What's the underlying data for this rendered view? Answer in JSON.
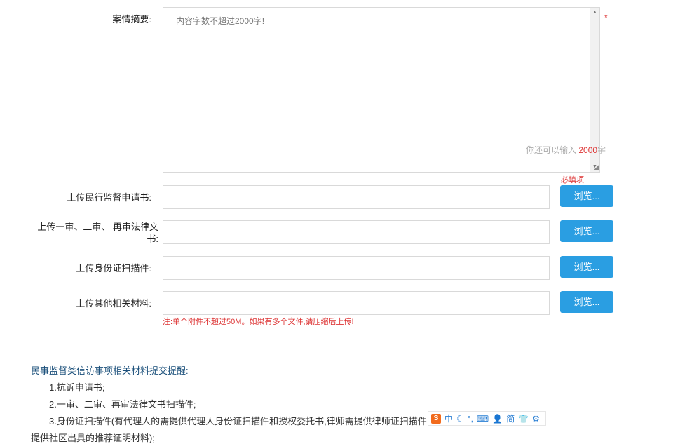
{
  "summary": {
    "label": "案情摘要:",
    "placeholder": "内容字数不超过2000字!",
    "required_mark": "*",
    "counter_prefix": "你还可以输入",
    "counter_value": "2000",
    "counter_suffix": "字",
    "required_hint": "必填项"
  },
  "uploads": [
    {
      "label": "上传民行监督申请书:",
      "button": "浏览..."
    },
    {
      "label": "上传一审、二审、 再审法律文书:",
      "button": "浏览..."
    },
    {
      "label": "上传身份证扫描件:",
      "button": "浏览..."
    },
    {
      "label": "上传其他相关材料:",
      "button": "浏览..."
    }
  ],
  "upload_note": "注:单个附件不超过50M。如果有多个文件,请压缩后上传!",
  "reminder": {
    "title": "民事监督类信访事项相关材料提交提醒:",
    "items": [
      "1.抗诉申请书;",
      "2.一审、二审、再审法律文书扫描件;",
      "3.身份证扫描件(有代理人的需提供代理人身份证扫描件和授权委托书,律师需提供律师证扫描件",
      "提供社区出具的推荐证明材料);"
    ]
  },
  "ime_toolbar": {
    "logo": "S",
    "mode": "中",
    "simplified": "简"
  }
}
